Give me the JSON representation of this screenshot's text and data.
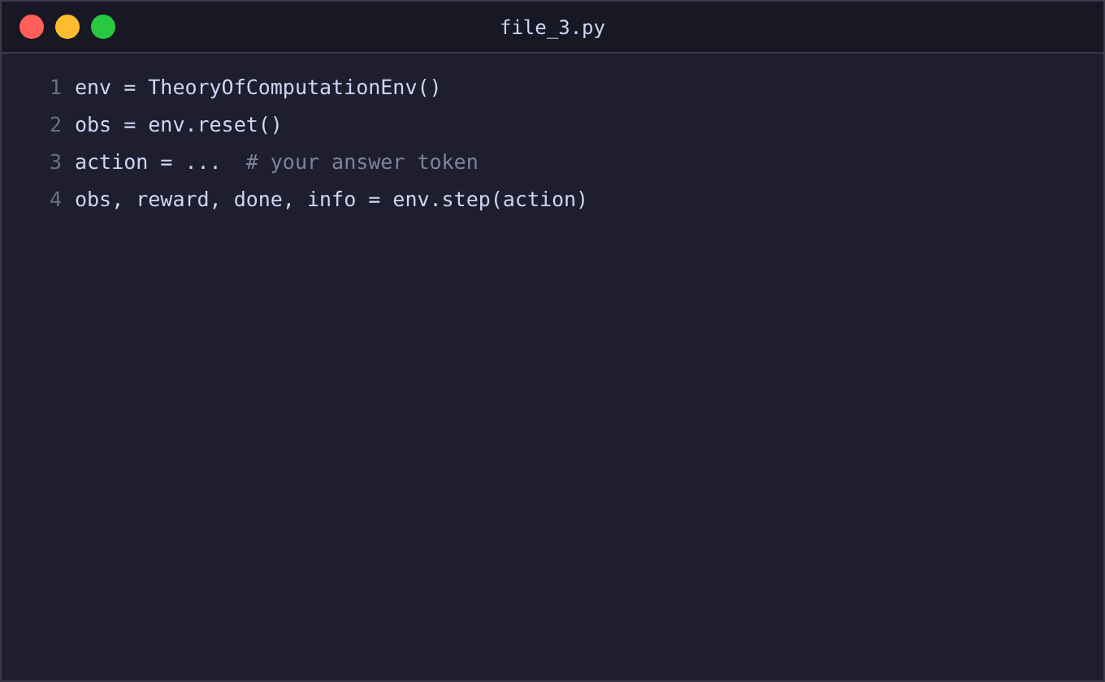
{
  "window": {
    "title": "file_3.py"
  },
  "lines": [
    {
      "number": "1",
      "segments": [
        {
          "kind": "code",
          "text": "env = TheoryOfComputationEnv()"
        }
      ]
    },
    {
      "number": "2",
      "segments": [
        {
          "kind": "code",
          "text": "obs = env.reset()"
        }
      ]
    },
    {
      "number": "3",
      "segments": [
        {
          "kind": "code",
          "text": "action = ...  "
        },
        {
          "kind": "comment",
          "text": "# your answer token"
        }
      ]
    },
    {
      "number": "4",
      "segments": [
        {
          "kind": "code",
          "text": "obs, reward, done, info = env.step(action)"
        }
      ]
    }
  ]
}
